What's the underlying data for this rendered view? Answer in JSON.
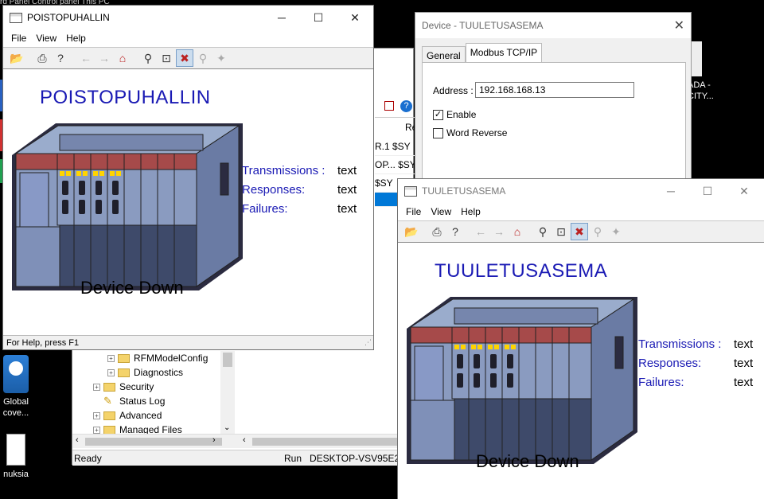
{
  "desktop": {
    "top_text": "rd Panel  Control panel  This PC",
    "icons": [
      {
        "label": "Global\ncove...",
        "icon": "global-discovery-icon"
      },
      {
        "label": "nuksia",
        "icon": "document-icon"
      },
      {
        "label": "ADA -\nCITY...",
        "icon": "scada-icon"
      }
    ]
  },
  "explorer": {
    "tree": [
      {
        "label": "RFMModelConfig",
        "indent": 2,
        "icon": "folder-icon"
      },
      {
        "label": "Diagnostics",
        "indent": 2,
        "icon": "folder-icon"
      },
      {
        "label": "Security",
        "indent": 1,
        "icon": "folder-icon"
      },
      {
        "label": "Status Log",
        "indent": 1,
        "icon": "status-log-icon"
      },
      {
        "label": "Advanced",
        "indent": 1,
        "icon": "folder-icon"
      },
      {
        "label": "Managed Files",
        "indent": 1,
        "icon": "folder-icon"
      }
    ],
    "list_header": "Re",
    "list_rows": [
      "R.1   $SY",
      "OP...  $SY",
      "       $SY"
    ],
    "status": {
      "ready": "Ready",
      "run": "Run",
      "machine": "DESKTOP-VSV95E2"
    }
  },
  "win1": {
    "title": "POISTOPUHALLIN",
    "menu": [
      "File",
      "View",
      "Help"
    ],
    "device_name": "POISTOPUHALLIN",
    "stats": [
      {
        "label": "Transmissions :",
        "value": "text"
      },
      {
        "label": "Responses:",
        "value": "text"
      },
      {
        "label": "Failures:",
        "value": "text"
      }
    ],
    "device_state": "Device Down",
    "status": "For Help, press F1"
  },
  "win2": {
    "title": "TUULETUSASEMA",
    "menu": [
      "File",
      "View",
      "Help"
    ],
    "device_name": "TUULETUSASEMA",
    "stats": [
      {
        "label": "Transmissions :",
        "value": "text"
      },
      {
        "label": "Responses:",
        "value": "text"
      },
      {
        "label": "Failures:",
        "value": "text"
      }
    ],
    "device_state": "Device Down"
  },
  "dialog": {
    "title": "Device - TUULETUSASEMA",
    "tabs": [
      "General",
      "Modbus TCP/IP"
    ],
    "address_label": "Address :",
    "address_value": "192.168.168.13",
    "enable_label": "Enable",
    "enable_checked": true,
    "word_reverse_label": "Word Reverse",
    "word_reverse_checked": false
  },
  "colors": {
    "title_blue": "#1a1ab4",
    "plc_body": "#8a9bc0",
    "plc_red": "#a64a4a",
    "led": "#ffd400"
  }
}
